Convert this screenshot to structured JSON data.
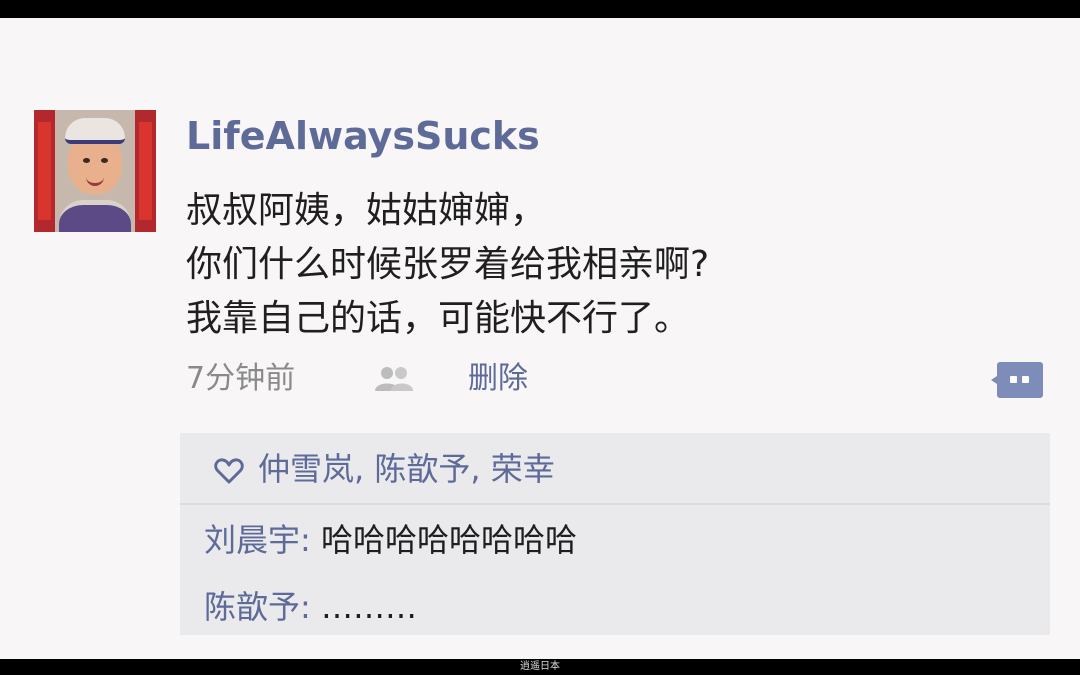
{
  "post": {
    "username": "LifeAlwaysSucks",
    "body_lines": [
      "叔叔阿姨，姑姑婶婶，",
      "你们什么时候张罗着给我相亲啊?",
      "我靠自己的话，可能快不行了。"
    ],
    "time": "7分钟前",
    "delete_label": "删除"
  },
  "likes": {
    "names": "仲雪岚, 陈歆予, 荣幸"
  },
  "comments": [
    {
      "author": "刘晨宇:",
      "text": " 哈哈哈哈哈哈哈哈"
    },
    {
      "author": "陈歆予:",
      "text": " ………"
    }
  ],
  "watermark": "逍遥日本",
  "icons": {
    "friends": "friends-icon",
    "comment": "comment-icon",
    "heart": "heart-icon"
  },
  "colors": {
    "link": "#5e6b99",
    "text": "#1f1f1f",
    "meta": "#8a8a8a",
    "background": "#f8f6f7",
    "panel": "#eae9ec"
  }
}
